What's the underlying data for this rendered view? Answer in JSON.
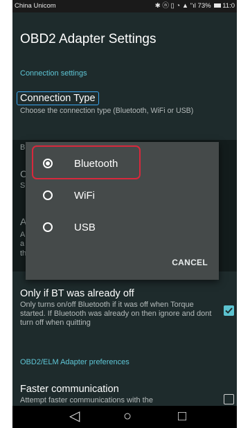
{
  "status": {
    "carrier": "China Unicom",
    "right": "✱ ⓝ ▯ ◔ ▲ \"ıl 73%",
    "time": "11:0"
  },
  "app": {
    "title": "OBD2 Adapter Settings"
  },
  "sections": {
    "connection": "Connection settings",
    "adapter": "OBD2/ELM Adapter preferences"
  },
  "prefs": {
    "connection_type_title": "Connection Type",
    "connection_type_summary": "Choose the connection type (Bluetooth, WiFi or USB)",
    "bt_off_title": "Only if BT was already off",
    "bt_off_summary": "Only turns on/off Bluetooth if it was off when Torque started. If Bluetooth was already on then ignore and dont turn off when quitting",
    "faster_title": "Faster communication",
    "faster_summary": "Attempt faster communications with the"
  },
  "peek": [
    "B",
    "C",
    "S",
    "A",
    "A",
    "a",
    "th"
  ],
  "dialog": {
    "options": [
      {
        "label": "Bluetooth",
        "selected": true
      },
      {
        "label": "WiFi",
        "selected": false
      },
      {
        "label": "USB",
        "selected": false
      }
    ],
    "cancel": "CANCEL"
  },
  "nav": {
    "back": "◁",
    "home": "○",
    "recents": "□"
  },
  "colors": {
    "accent": "#5fc6d6",
    "background": "#1e2b2c",
    "dialog": "#454a4a",
    "highlight_red": "#d8283c",
    "highlight_blue": "#3aa6f0"
  }
}
